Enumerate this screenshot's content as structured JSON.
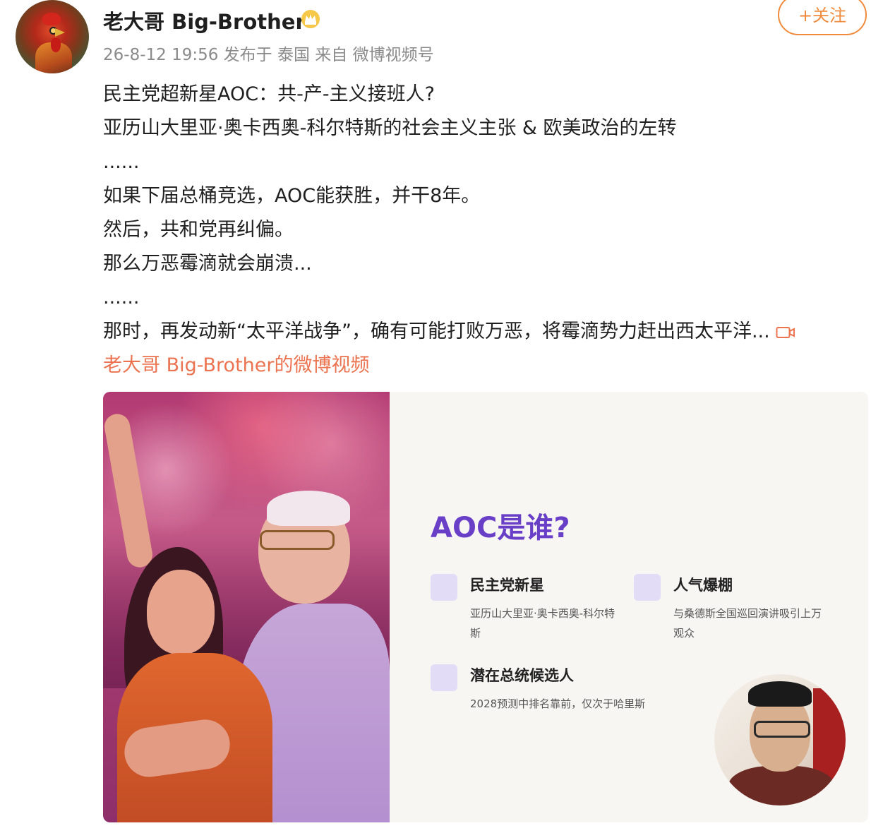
{
  "post": {
    "author_name": "老大哥 Big-Brother",
    "meta": "26-8-12 19:56 发布于 泰国 来自 微博视频号",
    "follow_label": "+关注",
    "lines": [
      "民主党超新星AOC：共-产-主义接班人?",
      "亚历山大里亚·奥卡西奥-科尔特斯的社会主义主张 & 欧美政治的左转",
      "......",
      "如果下届总桶竞选，AOC能获胜，并干8年。",
      "然后，共和党再纠偏。",
      "那么万恶霉滴就会崩溃...",
      "......",
      "那时，再发动新“太平洋战争”，确有可能打败万恶，将霉滴势力赶出西太平洋..."
    ],
    "video_link_text": "老大哥 Big-Brother的微博视频"
  },
  "video": {
    "slide_title": "AOC是谁?",
    "cards": [
      {
        "heading": "民主党新星",
        "text": "亚历山大里亚·奥卡西奥-科尔特斯"
      },
      {
        "heading": "人气爆棚",
        "text": "与桑德斯全国巡回演讲吸引上万观众"
      },
      {
        "heading": "潜在总统候选人",
        "text": "2028预测中排名靠前，仅次于哈里斯"
      }
    ]
  },
  "icons": {
    "crown": "crown-badge-icon",
    "video": "video-icon"
  },
  "colors": {
    "accent_orange": "#eb7350",
    "follow_orange": "#f08a3c",
    "slide_title_purple": "#6a3fc8",
    "card_box": "#e3dcf7"
  }
}
